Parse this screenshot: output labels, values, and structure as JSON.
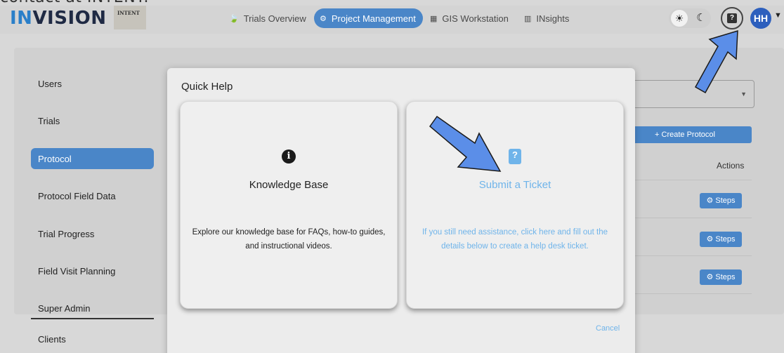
{
  "header_text": "contact at INTENT.",
  "app": {
    "logo_in": "IN",
    "logo_rest": "VISION",
    "client_logo": "INTENT"
  },
  "nav": [
    {
      "label": "Trials Overview",
      "icon": "leaf-icon"
    },
    {
      "label": "Project Management",
      "icon": "gear-icon",
      "active": true
    },
    {
      "label": "GIS Workstation",
      "icon": "grid-icon"
    },
    {
      "label": "INsights",
      "icon": "chart-icon"
    }
  ],
  "topbar": {
    "avatar_initials": "HH",
    "help_glyph": "?"
  },
  "sidebar": {
    "items": [
      "Users",
      "Trials",
      "Protocol",
      "Protocol Field Data",
      "Trial Progress",
      "Field Visit Planning"
    ],
    "active_index": 2,
    "section_heading": "Super Admin",
    "section_items": [
      "Clients"
    ]
  },
  "background": {
    "create_label": "+ Create Protocol",
    "actions_header": "Actions",
    "steps_label": "Steps"
  },
  "modal": {
    "title": "Quick Help",
    "kb_title": "Knowledge Base",
    "kb_desc": "Explore our knowledge base for FAQs, how-to guides, and instructional videos.",
    "ticket_title": "Submit a Ticket",
    "ticket_desc": "If you still need assistance, click here and fill out the details below to create a help desk ticket.",
    "cancel": "Cancel"
  },
  "colors": {
    "accent": "#4a86c8",
    "link": "#6fb4ea",
    "annotation_arrow": "#5b8ee8"
  }
}
